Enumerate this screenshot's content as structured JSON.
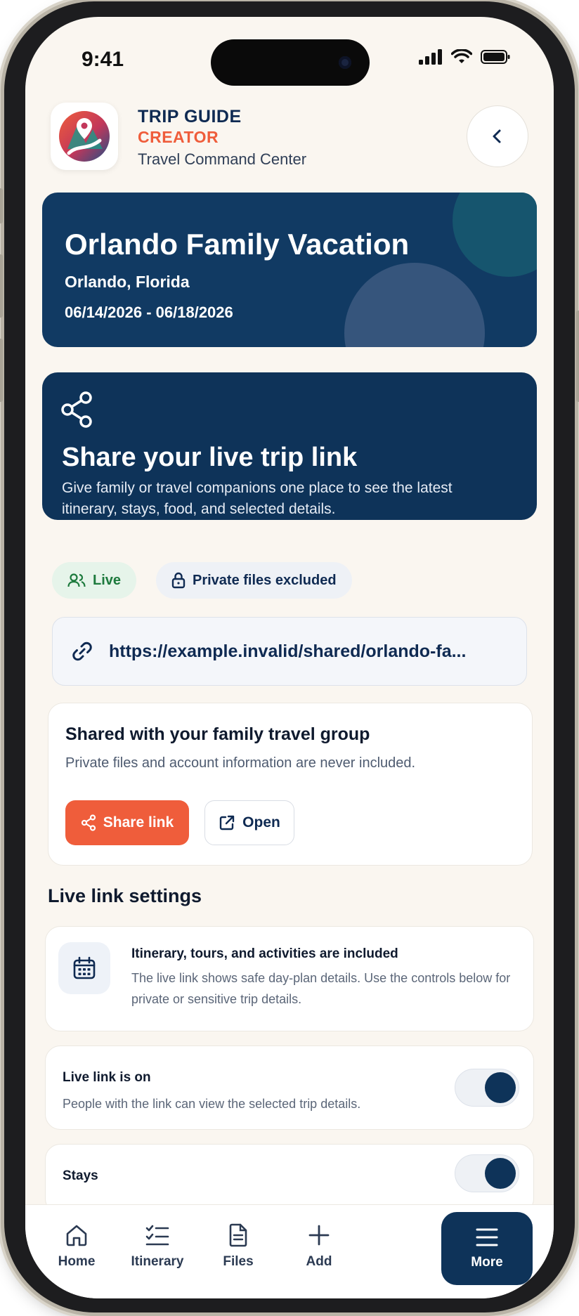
{
  "status_bar": {
    "time": "9:41"
  },
  "header": {
    "brand_line1": "TRIP GUIDE",
    "brand_line2": "CREATOR",
    "subtitle": "Travel Command Center"
  },
  "trip": {
    "title": "Orlando Family Vacation",
    "location": "Orlando, Florida",
    "dates": "06/14/2026 - 06/18/2026"
  },
  "share_card": {
    "title": "Share your live trip link",
    "description": "Give family or travel companions one place to see the latest itinerary, stays, food, and selected details."
  },
  "badges": {
    "live": "Live",
    "private": "Private files excluded"
  },
  "link": {
    "url": "https://example.invalid/shared/orlando-fa..."
  },
  "shared_card": {
    "title": "Shared with your family travel group",
    "subtitle": "Private files and account information are never included.",
    "share_button": "Share link",
    "open_button": "Open"
  },
  "settings": {
    "section_title": "Live link settings",
    "info_title": "Itinerary, tours, and activities are included",
    "info_desc": "The live link shows safe day-plan details. Use the controls below for private or sensitive trip details.",
    "live_link": {
      "title": "Live link is on",
      "subtitle": "People with the link can view the selected trip details.",
      "on": true
    },
    "stays": {
      "title": "Stays",
      "on": true
    }
  },
  "nav": {
    "items": [
      {
        "label": "Home",
        "icon": "home-icon"
      },
      {
        "label": "Itinerary",
        "icon": "checklist-icon"
      },
      {
        "label": "Files",
        "icon": "file-icon"
      },
      {
        "label": "Add",
        "icon": "plus-icon"
      },
      {
        "label": "More",
        "icon": "menu-icon",
        "active": true
      }
    ]
  },
  "colors": {
    "navy": "#0e3359",
    "accent": "#ef5d3b",
    "live_green": "#1d7a3d",
    "background": "#faf6f0"
  }
}
